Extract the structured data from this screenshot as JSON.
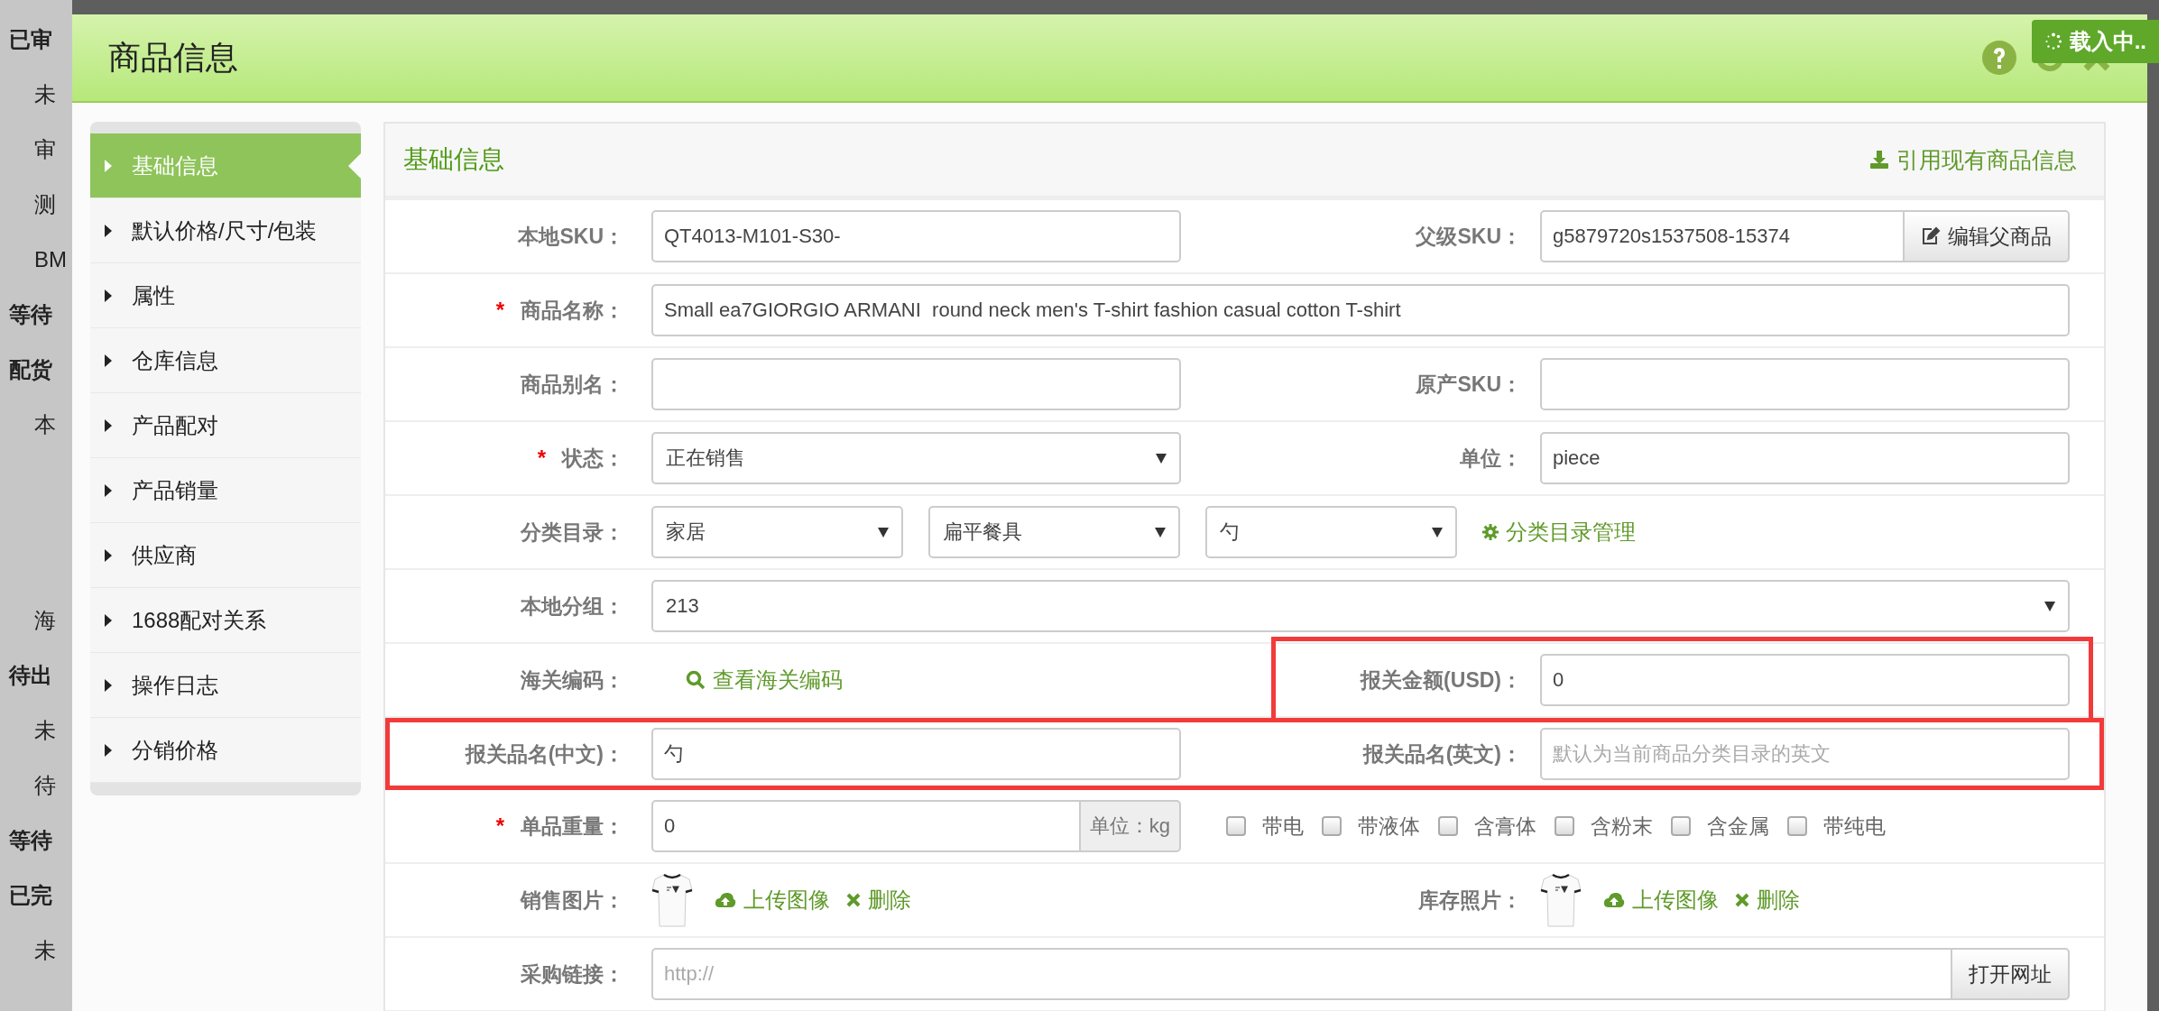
{
  "backdrop": {
    "upper": [
      {
        "label": "已审",
        "kind": "heading"
      },
      {
        "label": "未",
        "kind": "item"
      },
      {
        "label": "审",
        "kind": "item"
      },
      {
        "label": "测",
        "kind": "item"
      },
      {
        "label": "BM",
        "kind": "item"
      },
      {
        "label": "等待",
        "kind": "heading"
      },
      {
        "label": "配货",
        "kind": "heading"
      },
      {
        "label": "本",
        "kind": "item"
      }
    ],
    "lower": [
      {
        "label": "海",
        "kind": "item"
      },
      {
        "label": "待出",
        "kind": "heading"
      },
      {
        "label": "未",
        "kind": "item"
      },
      {
        "label": "待",
        "kind": "item"
      },
      {
        "label": "等待",
        "kind": "heading"
      },
      {
        "label": "已完",
        "kind": "heading"
      },
      {
        "label": "未",
        "kind": "item"
      }
    ],
    "loading": "载入中.."
  },
  "window": {
    "title": "商品信息"
  },
  "menu": [
    {
      "label": "基础信息",
      "selected": true
    },
    {
      "label": "默认价格/尺寸/包装",
      "selected": false
    },
    {
      "label": "属性",
      "selected": false
    },
    {
      "label": "仓库信息",
      "selected": false
    },
    {
      "label": "产品配对",
      "selected": false
    },
    {
      "label": "产品销量",
      "selected": false
    },
    {
      "label": "供应商",
      "selected": false
    },
    {
      "label": "1688配对关系",
      "selected": false
    },
    {
      "label": "操作日志",
      "selected": false
    },
    {
      "label": "分销价格",
      "selected": false
    }
  ],
  "panel": {
    "title": "基础信息",
    "action": "引用现有商品信息"
  },
  "rows": [
    {
      "highlighted": false,
      "fields": [
        {
          "label": "本地SKU：",
          "required": false,
          "kind": "input",
          "value": "QT4013-M101-S30-",
          "highlighted": false
        },
        {
          "label": "父级SKU：",
          "required": false,
          "kind": "input-button",
          "value": "g5879720s1537508-15374",
          "button": "编辑父商品",
          "highlighted": false
        }
      ]
    },
    {
      "highlighted": false,
      "fields": [
        {
          "label": "商品名称：",
          "required": "*",
          "kind": "input",
          "value": "Small ea7GIORGIO ARMANI  round neck men's T-shirt fashion casual cotton T-shirt",
          "highlighted": false
        }
      ]
    },
    {
      "highlighted": false,
      "fields": [
        {
          "label": "商品别名：",
          "required": false,
          "kind": "input",
          "highlighted": false
        },
        {
          "label": "原产SKU：",
          "required": false,
          "kind": "input",
          "highlighted": false
        }
      ]
    },
    {
      "highlighted": false,
      "fields": [
        {
          "label": "状态：",
          "required": "*",
          "kind": "select",
          "options": [
            "正在销售"
          ],
          "highlighted": false
        },
        {
          "label": "单位：",
          "required": false,
          "kind": "input",
          "value": "piece",
          "highlighted": false
        }
      ]
    },
    {
      "highlighted": false,
      "fields": [
        {
          "label": "分类目录：",
          "required": false,
          "kind": "select",
          "options": [
            "家居",
            "扁平餐具",
            "勺"
          ],
          "link": "分类目录管理",
          "highlighted": false
        }
      ]
    },
    {
      "highlighted": false,
      "fields": [
        {
          "label": "本地分组：",
          "required": false,
          "kind": "select",
          "options": [
            "213"
          ],
          "highlighted": false
        }
      ]
    },
    {
      "highlighted": false,
      "fields": [
        {
          "label": "海关编码：",
          "required": false,
          "kind": "link",
          "link": "查看海关编码",
          "highlighted": false
        },
        {
          "label": "报关金额(USD)：",
          "required": false,
          "kind": "input",
          "value": "0",
          "highlighted": true
        }
      ]
    },
    {
      "highlighted": true,
      "fields": [
        {
          "label": "报关品名(中文)：",
          "required": false,
          "kind": "input",
          "value": "勺",
          "highlighted": false
        },
        {
          "label": "报关品名(英文)：",
          "required": false,
          "kind": "input",
          "placeholder": "默认为当前商品分类目录的英文",
          "highlighted": false
        }
      ]
    },
    {
      "highlighted": false,
      "fields": [
        {
          "label": "单品重量：",
          "required": "*",
          "kind": "input-addon",
          "value": "0",
          "addon": "单位：kg",
          "highlighted": false
        },
        {
          "kind": "checkboxes",
          "highlighted": false,
          "items": [
            {
              "label": "带电",
              "checked": false
            },
            {
              "label": "带液体",
              "checked": false
            },
            {
              "label": "含膏体",
              "checked": false
            },
            {
              "label": "含粉末",
              "checked": false
            },
            {
              "label": "含金属",
              "checked": false
            },
            {
              "label": "带纯电",
              "checked": false
            }
          ]
        }
      ]
    },
    {
      "highlighted": false,
      "fields": [
        {
          "label": "销售图片：",
          "required": false,
          "kind": "image",
          "upload": "上传图像",
          "remove": "删除",
          "highlighted": false
        },
        {
          "label": "库存照片：",
          "required": false,
          "kind": "image",
          "upload": "上传图像",
          "remove": "删除",
          "highlighted": false
        }
      ]
    },
    {
      "highlighted": false,
      "fields": [
        {
          "label": "采购链接：",
          "required": false,
          "kind": "input-button",
          "placeholder": "http://",
          "button": "打开网址",
          "highlighted": false
        }
      ]
    }
  ]
}
